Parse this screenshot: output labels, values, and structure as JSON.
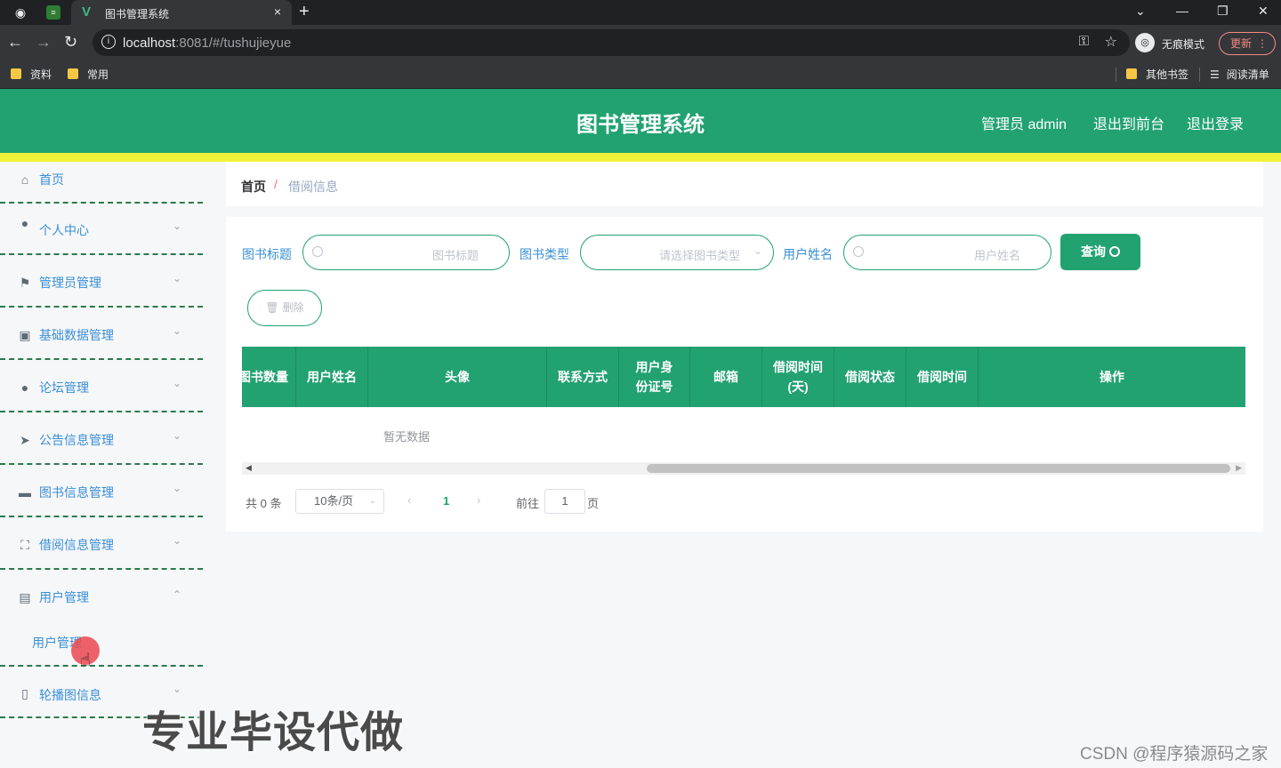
{
  "browser": {
    "tab_title": "图书管理系统",
    "tab_close": "×",
    "new_tab": "+",
    "url_host": "localhost",
    "url_rest": ":8081/#/tushujieyue",
    "incognito_label": "无痕模式",
    "update_label": "更新",
    "bookmarks": [
      "资料",
      "常用"
    ],
    "bookmarks_right": [
      "其他书签",
      "阅读清单"
    ]
  },
  "header": {
    "title": "图书管理系统",
    "admin_label": "管理员 admin",
    "front_link": "退出到前台",
    "logout_link": "退出登录"
  },
  "sidebar": {
    "items": [
      {
        "label": "首页",
        "icon": "home-icon"
      },
      {
        "label": "个人中心",
        "icon": "user-icon"
      },
      {
        "label": "管理员管理",
        "icon": "flag-icon"
      },
      {
        "label": "基础数据管理",
        "icon": "picture-icon"
      },
      {
        "label": "论坛管理",
        "icon": "user-icon"
      },
      {
        "label": "公告信息管理",
        "icon": "send-icon"
      },
      {
        "label": "图书信息管理",
        "icon": "printer-icon"
      },
      {
        "label": "借阅信息管理",
        "icon": "frame-icon"
      },
      {
        "label": "用户管理",
        "icon": "clipboard-icon"
      },
      {
        "label": "轮播图信息",
        "icon": "microphone-icon"
      }
    ],
    "sub_item": "用户管理"
  },
  "breadcrumb": {
    "home": "首页",
    "separator": "/",
    "current": "借阅信息"
  },
  "search": {
    "book_title_label": "图书标题",
    "book_title_placeholder": "图书标题",
    "book_type_label": "图书类型",
    "book_type_placeholder": "请选择图书类型",
    "user_name_label": "用户姓名",
    "user_name_placeholder": "用户姓名",
    "query_label": "查询",
    "delete_label": "删除"
  },
  "table": {
    "columns": [
      "图书数量",
      "用户姓名",
      "头像",
      "联系方式",
      "用户身份证号",
      "邮箱",
      "借阅时间(天)",
      "借阅状态",
      "借阅时间",
      "操作"
    ],
    "empty_text": "暂无数据"
  },
  "pager": {
    "total": "共 0 条",
    "page_size": "10条/页",
    "current_page": "1",
    "goto_label": "前往",
    "goto_value": "1",
    "goto_unit": "页"
  },
  "overlay": {
    "watermark": "专业毕设代做",
    "credit": "CSDN @程序猿源码之家"
  },
  "colors": {
    "primary": "#22a271",
    "accent_bar": "#f2f23a",
    "menu_text": "#3a8fd6"
  }
}
